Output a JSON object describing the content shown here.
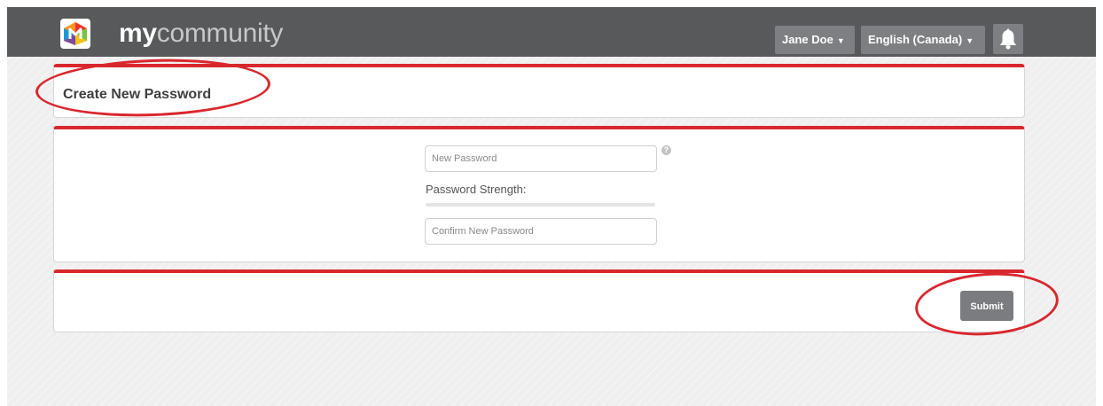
{
  "header": {
    "brand_bold": "my",
    "brand_light": "community",
    "user_menu_label": "Jane Doe",
    "language_menu_label": "English (Canada)",
    "logo_icon": "mycommunity-logo-icon",
    "notifications_icon": "bell-icon"
  },
  "title_panel": {
    "title": "Create New Password"
  },
  "form": {
    "new_password_placeholder": "New Password",
    "new_password_value": "",
    "help_icon": "question-icon",
    "strength_label": "Password Strength:",
    "strength_level": 0,
    "confirm_password_placeholder": "Confirm New Password",
    "confirm_password_value": ""
  },
  "actions": {
    "submit_label": "Submit"
  },
  "colors": {
    "header_bg": "#58595b",
    "accent_red": "#d9272e",
    "button_gray": "#7a7c7f"
  }
}
